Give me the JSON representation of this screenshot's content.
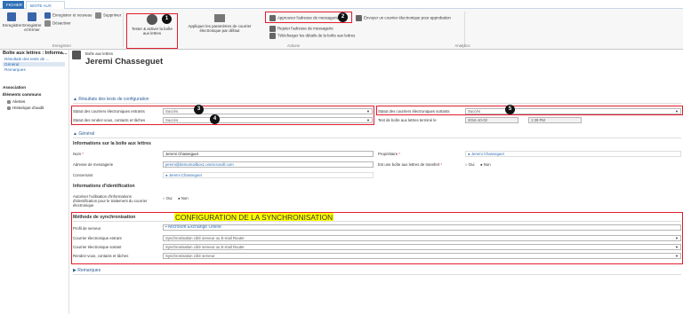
{
  "tabs": [
    "FICHIER",
    "BOITE AUX LETTRES"
  ],
  "ribbon": {
    "save": "Enregistrer",
    "save_close": "Enregistrer et fermer",
    "save_new": "Enregistrer et nouveau",
    "deactivate": "Désactiver",
    "delete": "Supprimer",
    "group_record": "Enregistrer",
    "test_enable": "Tester & activer la boîte aux lettres",
    "apply_default": "Appliquer les paramètres de courrier électronique par défaut",
    "approve": "Approuver l'adresse de messagerie",
    "reject": "Rejeter l'adresse de messagerie",
    "download_details": "Télécharger les détails de la boîte aux lettres",
    "send_approval": "Envoyer un courrier électronique pour approbation",
    "group_actions": "Actions",
    "group_analytics": "Analytics"
  },
  "nav": {
    "title": "Boîte aux lettres : Informa...",
    "items": [
      "Résultats des tests de ...",
      "Général",
      "Remarques"
    ],
    "section_assoc": "Association",
    "common": "Éléments communs",
    "alerts": "Alertes",
    "audit": "Historique d'audit"
  },
  "record": {
    "type": "Boîte aux lettres",
    "name": "Jeremi Chasseguet"
  },
  "test": {
    "section": "Résultats des tests de configuration",
    "incoming_label": "Statut des courriers électroniques entrants",
    "incoming_value": "Succès",
    "appointments_label": "Statut des rendez-vous, contacts et tâches",
    "appointments_value": "Succès",
    "outgoing_label": "Statut des courriers électroniques sortants",
    "outgoing_value": "Succès",
    "completed_label": "Test de boîte aux lettres terminé le",
    "completed_date": "2016-10-02",
    "completed_time": "1:39 PM"
  },
  "general": {
    "section": "Général",
    "info_header": "Informations sur la boîte aux lettres",
    "name_label": "Nom",
    "name_value": "Jeremi Chasseguet",
    "email_label": "Adresse de messagerie",
    "email_value": "jeremi@demomailbox1.onmicrosoft.com",
    "regarding_label": "Concernant",
    "regarding_value": "Jeremi Chasseguet",
    "owner_label": "Propriétaire",
    "owner_value": "Jeremi Chasseguet",
    "forward_label": "Est une boîte aux lettres de transfert",
    "no": "Non",
    "yes": "Oui",
    "cred_header": "Informations d'identification",
    "cred_label": "Autoriser l'utilisation d'informations d'identification pour le traitement du courrier électronique"
  },
  "sync": {
    "header": "Méthode de synchronisation",
    "banner": "CONFIGURATION DE LA SYNCHRONISATION",
    "profile_label": "Profil de serveur",
    "profile_value": "Microsoft Exchange Online",
    "incoming_label": "Courrier électronique entrant",
    "incoming_value": "Synchronisation côté serveur ou E-mail Router",
    "outgoing_label": "Courrier électronique sortant",
    "outgoing_value": "Synchronisation côté serveur ou E-mail Router",
    "appointments_label": "Rendez-vous, contacts et tâches",
    "appointments_value": "Synchronisation côté serveur"
  },
  "notes": {
    "section": "Remarques"
  },
  "badges": [
    "1",
    "2",
    "3",
    "4",
    "5"
  ],
  "colors": {
    "accent": "#2f6fb5",
    "highlight": "#ffff00",
    "annotation": "#e21d2e"
  }
}
